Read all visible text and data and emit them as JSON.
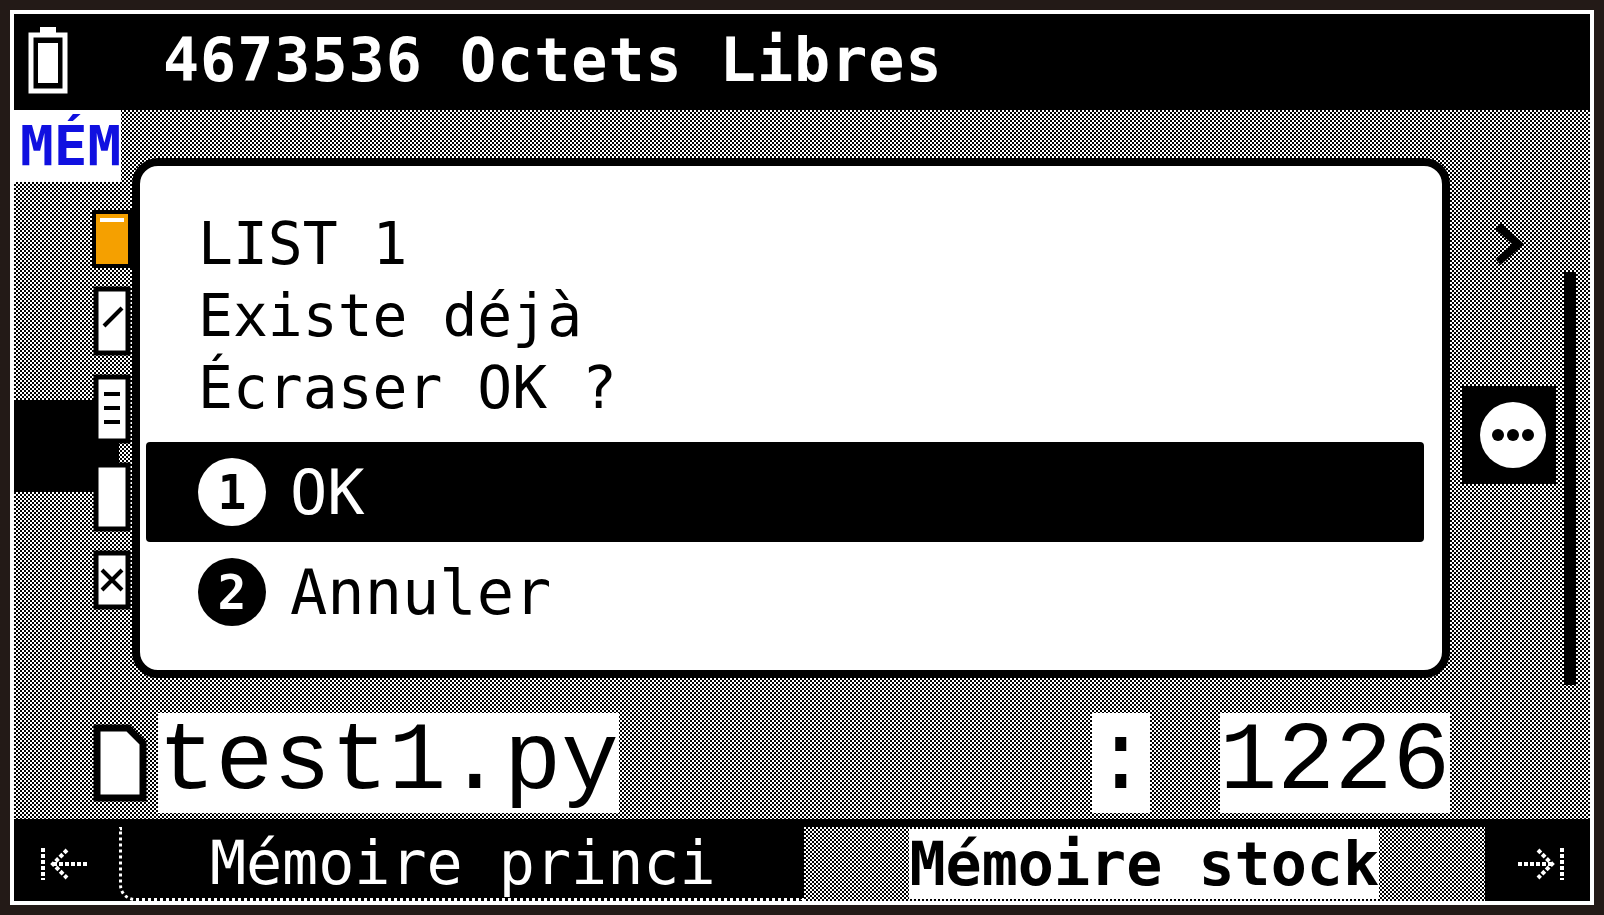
{
  "status_bar": {
    "free_memory": "4673536 Octets Libres"
  },
  "title": "MÉM",
  "files": [
    {
      "name": "test1.py",
      "separator": ":",
      "size": "1226"
    }
  ],
  "dialog": {
    "lines": [
      "LIST 1",
      "Existe déjà",
      "Écraser OK ?"
    ],
    "options": [
      {
        "number": "1",
        "label": "OK",
        "selected": true
      },
      {
        "number": "2",
        "label": "Annuler",
        "selected": false
      }
    ]
  },
  "tabs": [
    {
      "label": "Mémoire princi",
      "selected": true
    },
    {
      "label": "Mémoire stock",
      "selected": false
    }
  ]
}
